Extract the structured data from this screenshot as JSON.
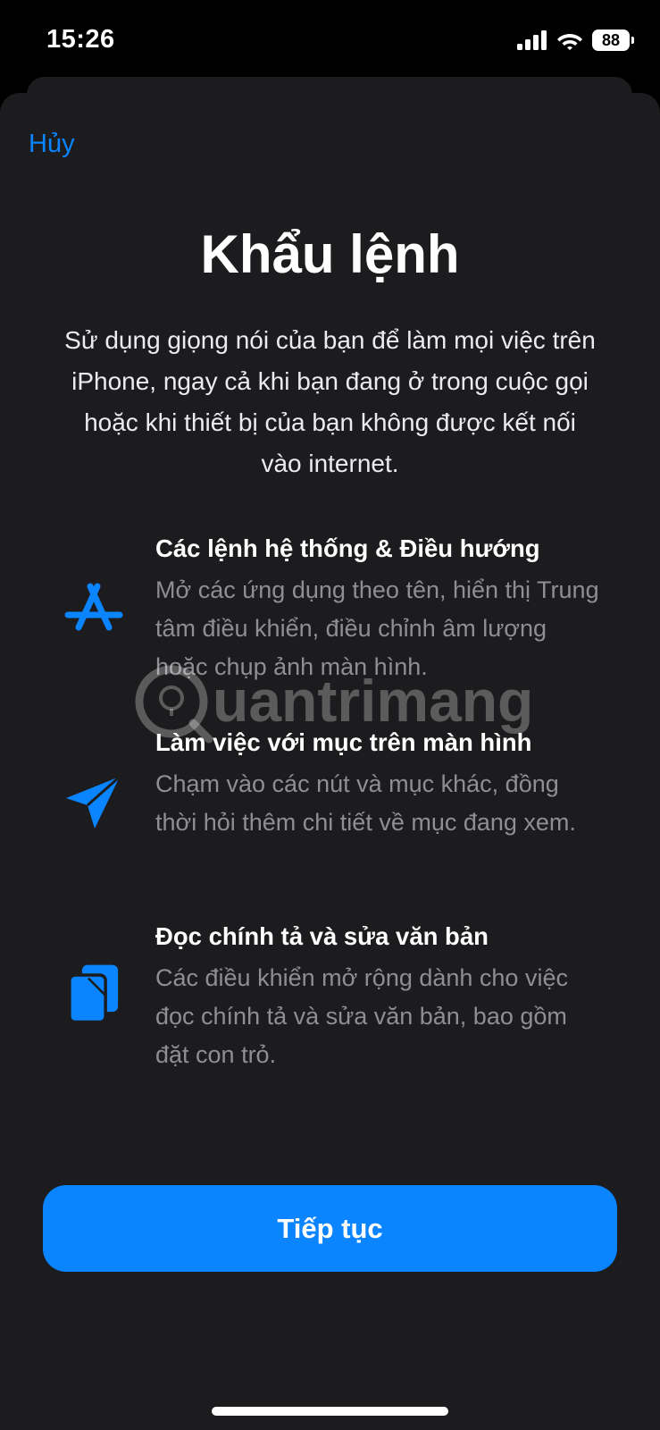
{
  "status_bar": {
    "time": "15:26",
    "battery": "88"
  },
  "header": {
    "cancel_label": "Hủy"
  },
  "main": {
    "title": "Khẩu lệnh",
    "intro": "Sử dụng giọng nói của bạn để làm mọi việc trên iPhone, ngay cả khi bạn đang ở trong cuộc gọi hoặc khi thiết bị của bạn không được kết nối vào internet."
  },
  "features": [
    {
      "icon": "app-store-icon",
      "title": "Các lệnh hệ thống & Điều hướng",
      "description": "Mở các ứng dụng theo tên, hiển thị Trung tâm điều khiển, điều chỉnh âm lượng hoặc chụp ảnh màn hình."
    },
    {
      "icon": "paper-plane-icon",
      "title": "Làm việc với mục trên màn hình",
      "description": "Chạm vào các nút và mục khác, đồng thời hỏi thêm chi tiết về mục đang xem."
    },
    {
      "icon": "documents-icon",
      "title": "Đọc chính tả và sửa văn bản",
      "description": "Các điều khiển mở rộng dành cho việc đọc chính tả và sửa văn bản, bao gồm đặt con trỏ."
    }
  ],
  "watermark": {
    "text": "uantrimang"
  },
  "footer": {
    "continue_label": "Tiếp tục"
  },
  "colors": {
    "accent": "#0a84ff",
    "sheet_background": "#1c1c1e",
    "secondary_text": "#8e8e93"
  }
}
